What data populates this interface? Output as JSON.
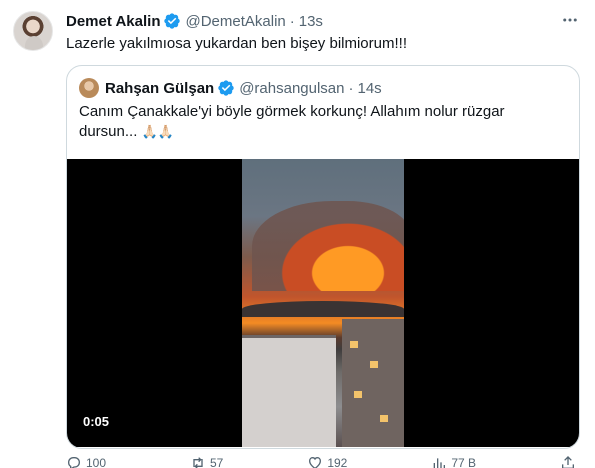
{
  "tweet": {
    "author_name": "Demet Akalin",
    "author_handle": "@DemetAkalin",
    "separator": "·",
    "time": "13s",
    "text": "Lazerle yakılmıosa yukardan ben bişey bilmiorum!!!"
  },
  "quote": {
    "author_name": "Rahşan Gülşan",
    "author_handle": "@rahsangulsan",
    "separator": "·",
    "time": "14s",
    "text": "Canım Çanakkale'yi böyle görmek korkunç! Allahım nolur rüzgar dursun...",
    "emoji": "🙏🏻🙏🏻",
    "video_time": "0:05"
  },
  "actions": [
    {
      "name": "reply",
      "count": "100"
    },
    {
      "name": "retweet",
      "count": "57"
    },
    {
      "name": "like",
      "count": "192"
    },
    {
      "name": "views",
      "count": "77 B"
    }
  ],
  "colors": {
    "verified": "#1d9bf0",
    "muted": "#536471",
    "border": "#cfd9de"
  },
  "icons": [
    "verified-badge-icon",
    "more-options-icon",
    "reply-icon",
    "retweet-icon",
    "like-icon",
    "views-icon",
    "share-icon"
  ]
}
